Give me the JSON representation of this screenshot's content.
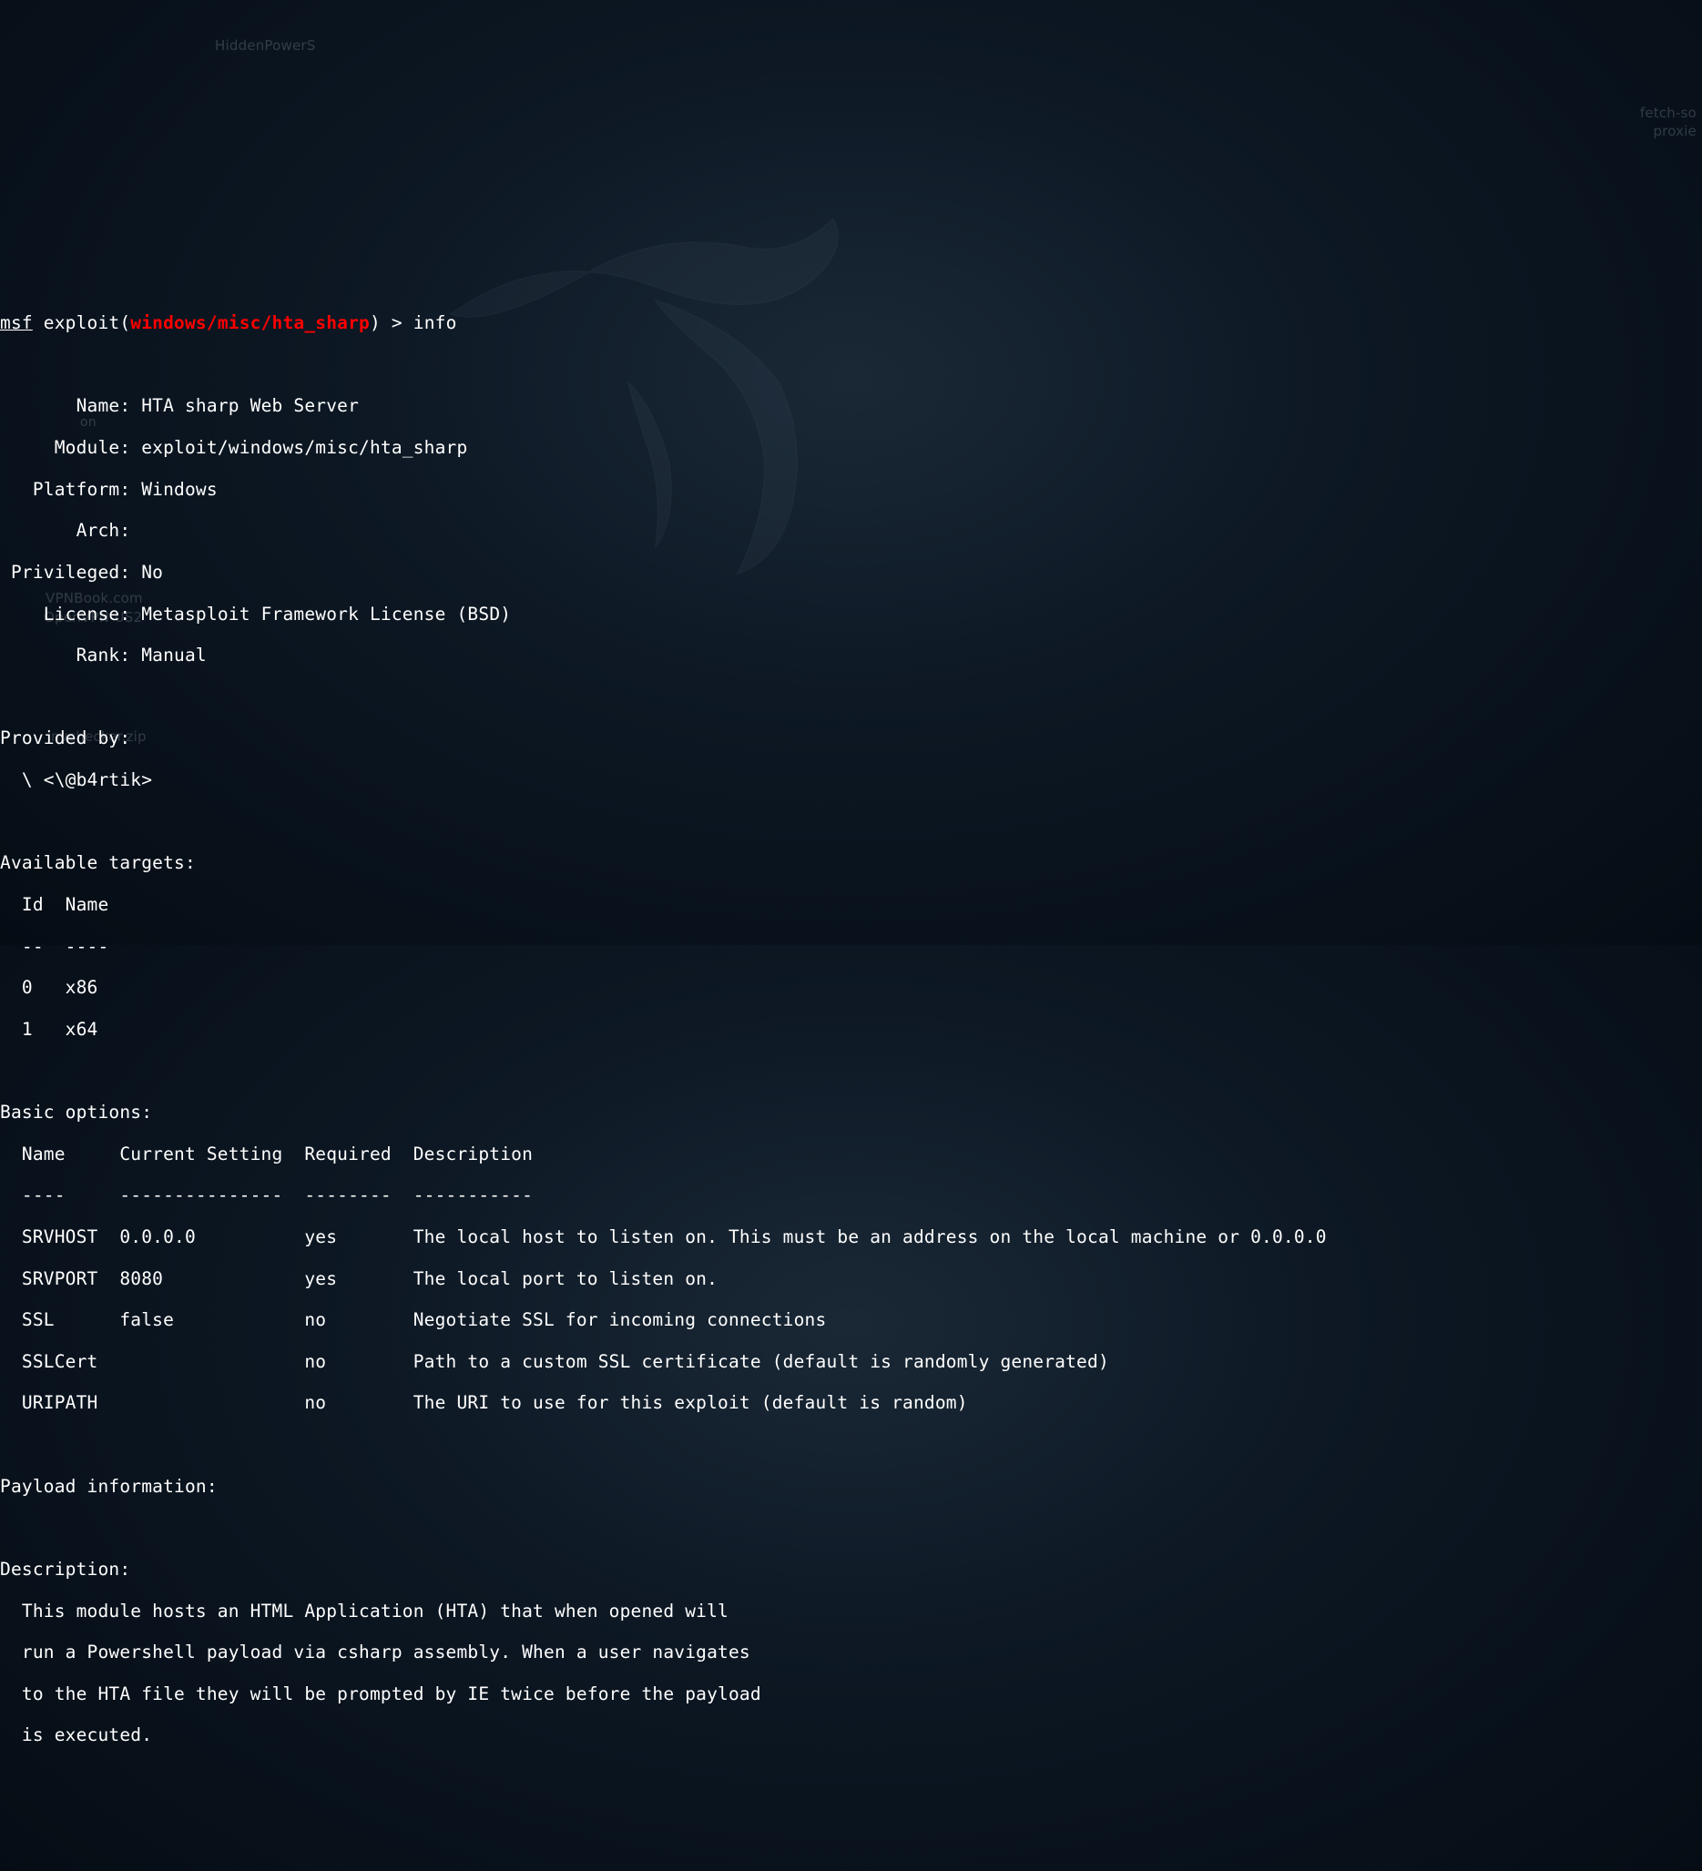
{
  "prompt": {
    "msf": "msf",
    "exploit_text": " exploit(",
    "module_path": "windows/misc/hta_sharp",
    "close_paren": ") > ",
    "command": "info"
  },
  "info": {
    "name_label": "       Name: ",
    "name_value": "HTA sharp Web Server",
    "module_label": "     Module: ",
    "module_value": "exploit/windows/misc/hta_sharp",
    "platform_label": "   Platform: ",
    "platform_value": "Windows",
    "arch_label": "       Arch: ",
    "arch_value": "",
    "privileged_label": " Privileged: ",
    "privileged_value": "No",
    "license_label": "    License: ",
    "license_value": "Metasploit Framework License (BSD)",
    "rank_label": "       Rank: ",
    "rank_value": "Manual"
  },
  "provided_by": {
    "header": "Provided by:",
    "author": "  \\ <\\@b4rtik>"
  },
  "targets": {
    "header": "Available targets:",
    "col_header": "  Id  Name",
    "col_divider": "  --  ----",
    "row0": "  0   x86",
    "row1": "  1   x64"
  },
  "options": {
    "header": "Basic options:",
    "col_header": "  Name     Current Setting  Required  Description",
    "col_divider": "  ----     ---------------  --------  -----------",
    "srvhost": "  SRVHOST  0.0.0.0          yes       The local host to listen on. This must be an address on the local machine or 0.0.0.0",
    "srvport": "  SRVPORT  8080             yes       The local port to listen on.",
    "ssl": "  SSL      false            no        Negotiate SSL for incoming connections",
    "sslcert": "  SSLCert                   no        Path to a custom SSL certificate (default is randomly generated)",
    "uripath": "  URIPATH                   no        The URI to use for this exploit (default is random)"
  },
  "payload_info": {
    "header": "Payload information:"
  },
  "description": {
    "header": "Description:",
    "line1": "  This module hosts an HTML Application (HTA) that when opened will ",
    "line2": "  run a Powershell payload via csharp assembly. When a user navigates ",
    "line3": "  to the HTA file they will be prompted by IE twice before the payload ",
    "line4": "  is executed."
  },
  "bg_labels": {
    "hidden_powers": "HiddenPowerS",
    "vpnbook": "VPNBook.com",
    "openvpn": "OpenVPN-US2",
    "nvchecker": "nvchecker.zip",
    "fetch": "fetch-so",
    "proxie": "proxie"
  }
}
